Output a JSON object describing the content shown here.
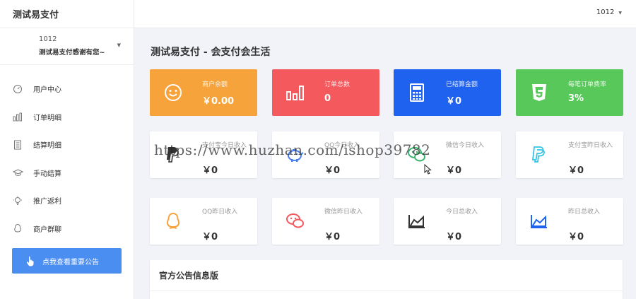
{
  "sidebar": {
    "brand": "测试易支付",
    "user": {
      "id": "1012",
      "name": "测试易支付感谢有您~"
    },
    "menu": [
      {
        "label": "用户中心",
        "icon": "dashboard-icon"
      },
      {
        "label": "订单明细",
        "icon": "bar-chart-icon"
      },
      {
        "label": "结算明细",
        "icon": "ledger-icon"
      },
      {
        "label": "手动结算",
        "icon": "graduation-cap-icon"
      },
      {
        "label": "推广返利",
        "icon": "lightbulb-icon"
      },
      {
        "label": "商户群聊",
        "icon": "qq-icon"
      }
    ],
    "notice_button": "点我查看重要公告"
  },
  "header": {
    "account": "1012"
  },
  "main": {
    "title": "测试易支付 - 会支付会生活",
    "stats": [
      {
        "label": "商户余额",
        "value": "￥0.00",
        "color": "#f6a33c",
        "icon": "smile-icon"
      },
      {
        "label": "订单总数",
        "value": "0",
        "color": "#f4595e",
        "icon": "bar-chart-icon"
      },
      {
        "label": "已结算金额",
        "value": "￥0",
        "color": "#1f62f0",
        "icon": "calculator-icon"
      },
      {
        "label": "每笔订单费率",
        "value": "3%",
        "color": "#58c85b",
        "icon": "css3-icon"
      }
    ],
    "income_row1": [
      {
        "label": "支付宝今日收入",
        "value": "￥0",
        "icon": "paypal-icon",
        "color": "#333333"
      },
      {
        "label": "QQ今日收入",
        "value": "￥0",
        "icon": "piggy-bank-icon",
        "color": "#4a7ff0"
      },
      {
        "label": "微信今日收入",
        "value": "￥0",
        "icon": "wechat-icon",
        "color": "#3cb46e"
      },
      {
        "label": "支付宝昨日收入",
        "value": "￥0",
        "icon": "paypal-icon",
        "color": "#34c4e8"
      }
    ],
    "income_row2": [
      {
        "label": "QQ昨日收入",
        "value": "￥0",
        "icon": "qq-icon",
        "color": "#f6a33c"
      },
      {
        "label": "微信昨日收入",
        "value": "￥0",
        "icon": "wechat-icon",
        "color": "#f4595e"
      },
      {
        "label": "今日总收入",
        "value": "￥0",
        "icon": "area-chart-icon",
        "color": "#333333"
      },
      {
        "label": "昨日总收入",
        "value": "￥0",
        "icon": "area-chart-icon",
        "color": "#1f62f0"
      }
    ],
    "announcement_title": "官方公告信息版"
  },
  "watermark": "https://www.huzhan.com/ishop39782"
}
